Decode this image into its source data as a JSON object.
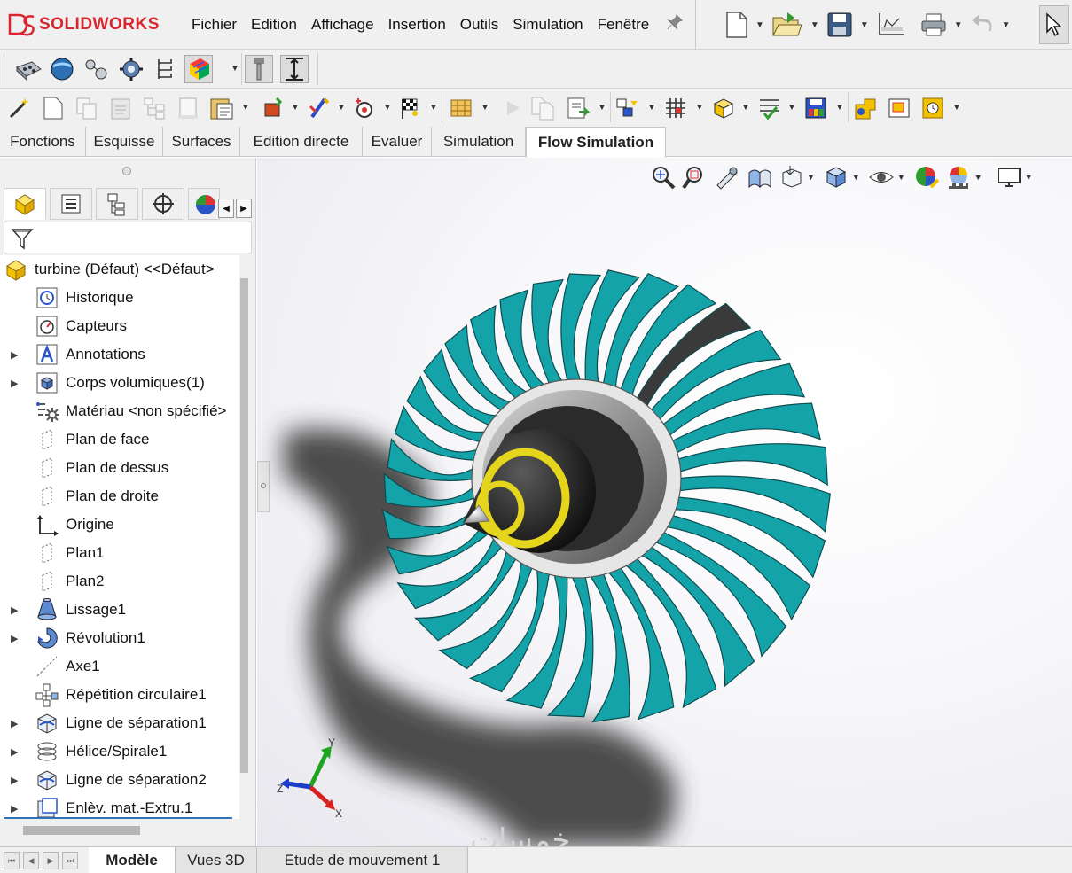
{
  "app": {
    "brand": "SOLIDWORKS"
  },
  "menu": [
    "Fichier",
    "Edition",
    "Affichage",
    "Insertion",
    "Outils",
    "Simulation",
    "Fenêtre"
  ],
  "command_tabs": [
    "Fonctions",
    "Esquisse",
    "Surfaces",
    "Edition directe",
    "Evaluer",
    "Simulation",
    "Flow Simulation"
  ],
  "active_command_tab": "Flow Simulation",
  "tree": {
    "root": "turbine  (Défaut) <<Défaut>",
    "items": [
      "Historique",
      "Capteurs",
      "Annotations",
      "Corps volumiques(1)",
      "Matériau <non spécifié>",
      "Plan de face",
      "Plan de dessus",
      "Plan de droite",
      "Origine",
      "Plan1",
      "Plan2",
      "Lissage1",
      "Révolution1",
      "Axe1",
      "Répétition circulaire1",
      "Ligne de séparation1",
      "Hélice/Spirale1",
      "Ligne de séparation2",
      "Enlèv. mat.-Extru.1"
    ]
  },
  "triad": {
    "x": "X",
    "y": "Y",
    "z": "Z"
  },
  "bottom_tabs": [
    "Modèle",
    "Vues 3D",
    "Etude de mouvement 1"
  ],
  "watermark": "خمسات",
  "colors": {
    "blade": "#14a3a8",
    "brand_red": "#d7262e",
    "cone_yellow": "#e6d51d",
    "selected_blade": "#3a3a3a"
  }
}
